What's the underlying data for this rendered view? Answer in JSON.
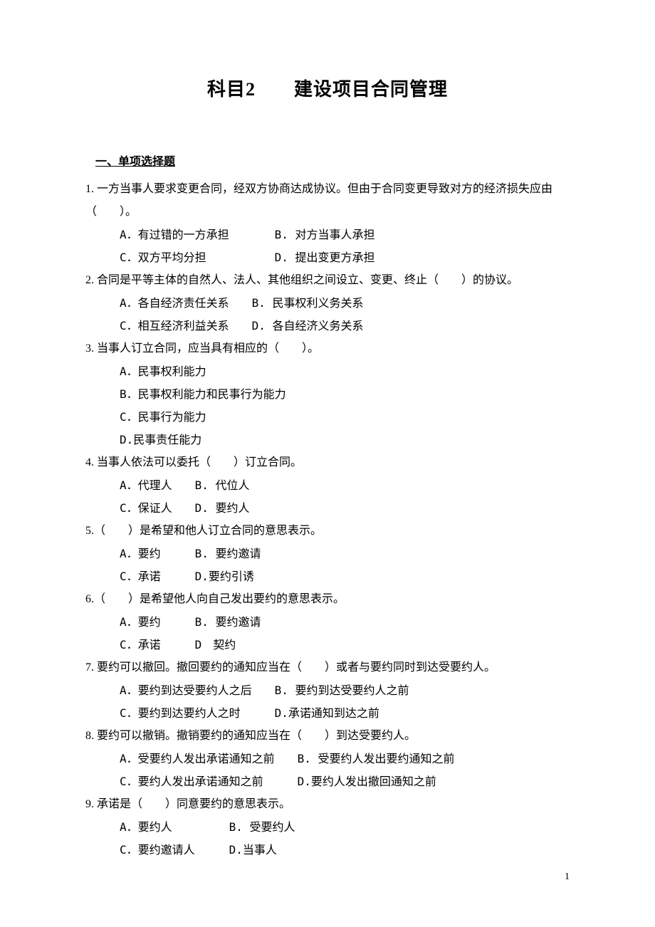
{
  "title": "科目2　　建设项目合同管理",
  "section_heading": "一、单项选择题",
  "page_number": "1",
  "questions": [
    {
      "text": "1. 一方当事人要求变更合同，经双方协商达成协议。但由于合同变更导致对方的经济损失应由（　　）。",
      "opt_lines": [
        "A．有过错的一方承担　　　　B. 对方当事人承担",
        "C．双方平均分担　　　　　　D. 提出变更方承担"
      ]
    },
    {
      "text": "2. 合同是平等主体的自然人、法人、其他组织之间设立、变更、终止（　　）的协议。",
      "opt_lines": [
        "A．各自经济责任关系　　B. 民事权利义务关系",
        "C．相互经济利益关系　　D. 各自经济义务关系"
      ]
    },
    {
      "text": "3. 当事人订立合同，应当具有相应的（　　）。",
      "opt_lines": [
        "A．民事权利能力",
        "B．民事权利能力和民事行为能力",
        "C．民事行为能力",
        "D.民事责任能力"
      ]
    },
    {
      "text": "4. 当事人依法可以委托（　　）订立合同。",
      "opt_lines": [
        "A．代理人　　B. 代位人",
        "C．保证人　　D. 要约人"
      ]
    },
    {
      "text": "5.（　　）是希望和他人订立合同的意思表示。",
      "opt_lines": [
        "A．要约　　　B. 要约邀请",
        "C．承诺　　　D.要约引诱"
      ]
    },
    {
      "text": "6.（　　）是希望他人向自己发出要约的意思表示。",
      "opt_lines": [
        "A．要约　　　B. 要约邀请",
        "C．承诺　　　D　契约"
      ]
    },
    {
      "text": "7. 要约可以撤回。撤回要约的通知应当在（　　）或者与要约同时到达受要约人。",
      "opt_lines": [
        "A．要约到达受要约人之后　　B. 要约到达受要约人之前",
        "C．要约到达要约人之时　　　D.承诺通知到达之前"
      ]
    },
    {
      "text": "8. 要约可以撤销。撤销要约的通知应当在（　　）到达受要约人。",
      "opt_lines": [
        "A．受要约人发出承诺通知之前　　B. 受要约人发出要约通知之前",
        "C．要约人发出承诺通知之前　　　D.要约人发出撤回通知之前"
      ]
    },
    {
      "text": "9. 承诺是（　　）同意要约的意思表示。",
      "opt_lines": [
        "A．要约人　　　　　B. 受要约人",
        "C．要约邀请人　　　D.当事人"
      ]
    }
  ]
}
